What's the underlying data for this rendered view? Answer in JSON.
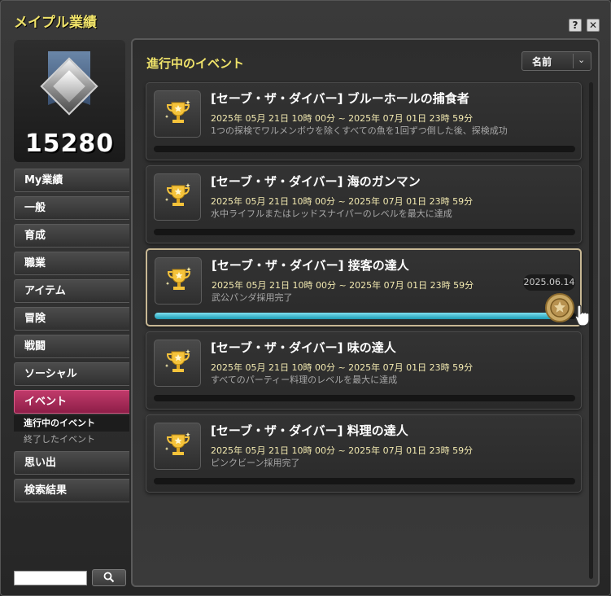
{
  "window": {
    "title": "メイプル業績",
    "help_label": "?",
    "close_label": "✕"
  },
  "profile": {
    "score": "15280",
    "emblem_icon": "diamond-rank-emblem"
  },
  "sidebar": {
    "items": [
      {
        "label": "My業績"
      },
      {
        "label": "一般"
      },
      {
        "label": "育成"
      },
      {
        "label": "職業"
      },
      {
        "label": "アイテム"
      },
      {
        "label": "冒険"
      },
      {
        "label": "戦闘"
      },
      {
        "label": "ソーシャル"
      },
      {
        "label": "イベント",
        "active": true
      },
      {
        "label": "思い出"
      },
      {
        "label": "検索結果"
      }
    ],
    "sub_items": [
      {
        "label": "進行中のイベント",
        "selected": true
      },
      {
        "label": "終了したイベント"
      }
    ]
  },
  "search": {
    "value": "",
    "icon": "search-icon"
  },
  "main": {
    "section_title": "進行中のイベント",
    "sort": {
      "selected": "名前",
      "arrow": "⌄"
    }
  },
  "events": [
    {
      "name": "[セーブ・ザ・ダイバー] ブルーホールの捕食者",
      "period": "2025年 05月 21日 10時 00分 ~ 2025年 07月 01日 23時 59分",
      "description": "1つの探検でワルメンボウを除くすべての魚を1回ずつ倒した後、探検成功",
      "progress": 0,
      "completed": false
    },
    {
      "name": "[セーブ・ザ・ダイバー] 海のガンマン",
      "period": "2025年 05月 21日 10時 00分 ~ 2025年 07月 01日 23時 59分",
      "description": "水中ライフルまたはレッドスナイパーのレベルを最大に達成",
      "progress": 0,
      "completed": false
    },
    {
      "name": "[セーブ・ザ・ダイバー] 接客の達人",
      "period": "2025年 05月 21日 10時 00分 ~ 2025年 07月 01日 23時 59分",
      "description": "武公パンダ採用完了",
      "progress": 1.0,
      "completed": true,
      "completed_date": "2025.06.14"
    },
    {
      "name": "[セーブ・ザ・ダイバー] 味の達人",
      "period": "2025年 05月 21日 10時 00分 ~ 2025年 07月 01日 23時 59分",
      "description": "すべてのパーティー料理のレベルを最大に達成",
      "progress": 0,
      "completed": false
    },
    {
      "name": "[セーブ・ザ・ダイバー] 料理の達人",
      "period": "2025年 05月 21日 10時 00分 ~ 2025年 07月 01日 23時 59分",
      "description": "ピンクビーン採用完了",
      "progress": 0,
      "completed": false
    }
  ],
  "colors": {
    "title_yellow": "#f0e36a",
    "active_menu": "#c03a6a",
    "progress_fill": "#1b9cb5",
    "seal_gold": "#c9a865"
  }
}
